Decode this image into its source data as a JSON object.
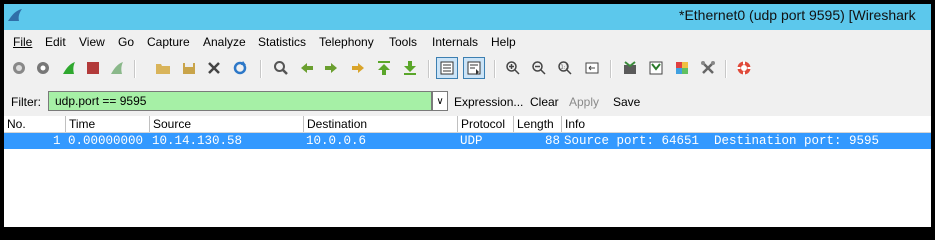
{
  "window": {
    "title": "*Ethernet0 (udp port 9595)   [Wireshark"
  },
  "menu": [
    {
      "label": "File"
    },
    {
      "label": "Edit"
    },
    {
      "label": "View"
    },
    {
      "label": "Go"
    },
    {
      "label": "Capture"
    },
    {
      "label": "Analyze"
    },
    {
      "label": "Statistics"
    },
    {
      "label": "Telephony"
    },
    {
      "label": "Tools"
    },
    {
      "label": "Internals"
    },
    {
      "label": "Help"
    }
  ],
  "filter": {
    "label": "Filter:",
    "value": "udp.port == 9595",
    "expression": "Expression...",
    "clear": "Clear",
    "apply": "Apply",
    "save": "Save"
  },
  "columns": [
    "No.",
    "Time",
    "Source",
    "Destination",
    "Protocol",
    "Length",
    "Info"
  ],
  "packets": [
    {
      "no": "1",
      "time": "0.00000000",
      "source": "10.14.130.58",
      "destination": "10.0.0.6",
      "protocol": "UDP",
      "length": "88",
      "info": "Source port: 64651  Destination port: 9595"
    }
  ],
  "colors": {
    "accent": "#5cc8ec",
    "selection": "#3399ff",
    "filter_ok": "#a6f0a6"
  }
}
